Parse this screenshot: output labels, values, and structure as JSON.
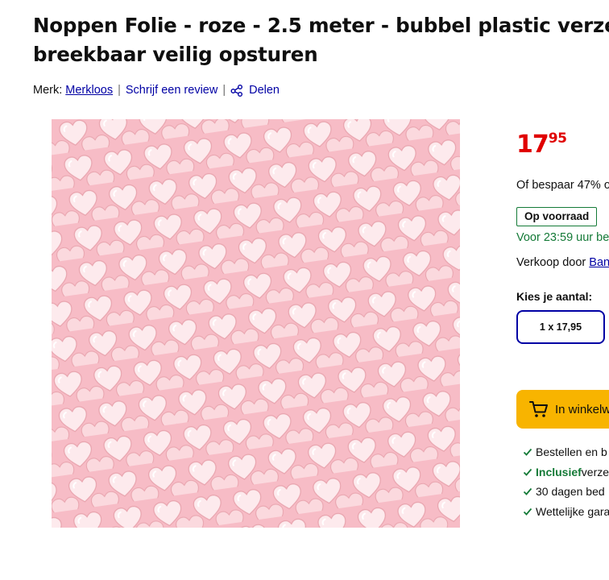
{
  "product": {
    "title_line1": "Noppen Folie - roze - 2.5 meter - bubbel plastic verze",
    "title_line2": "breekbaar veilig opsturen",
    "brand_label": "Merk:",
    "brand_value": "Merkloos",
    "review_link": "Schrijf een review",
    "share_link": "Delen",
    "image_alt": "Roze noppenfolie met hartvormige noppen"
  },
  "offer": {
    "price_main": "17",
    "price_cents": "95",
    "saving_text": "Of bespaar 47% o",
    "stock_badge": "Op voorraad",
    "delivery_text": "Voor 23:59 uur be",
    "seller_label": "Verkoop door",
    "seller_value": "Ban",
    "quantity_label": "Kies je aantal:",
    "quantity_option": "1 x 17,95",
    "cart_button": "In winkelw"
  },
  "usps": [
    {
      "bold": "",
      "text": "Bestellen en b"
    },
    {
      "bold": "Inclusief",
      "text": " verze"
    },
    {
      "bold": "",
      "text": "30 dagen bed"
    },
    {
      "bold": "",
      "text": "Wettelijke gara"
    }
  ],
  "colors": {
    "brand_blue": "#0000a4",
    "price_red": "#e00000",
    "stock_green": "#147a37",
    "cart_yellow": "#f8b400",
    "bubble_pink": "#f9c7cf"
  },
  "icons": {
    "share": "share-icon",
    "cart": "cart-icon",
    "check": "check-icon"
  }
}
